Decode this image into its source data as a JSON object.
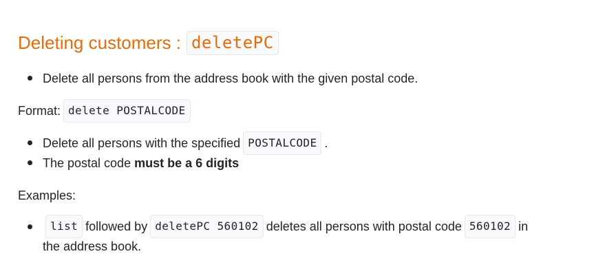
{
  "heading": {
    "text": "Deleting customers :",
    "code": "deletePC"
  },
  "description": {
    "item1": "Delete all persons from the address book with the given postal code."
  },
  "format": {
    "label": "Format:",
    "code": "delete POSTALCODE"
  },
  "details": {
    "item1_prefix": "Delete all persons with the specified",
    "item1_code": "POSTALCODE",
    "item1_suffix": ".",
    "item2_prefix": "The postal code",
    "item2_bold": "must be a 6 digits"
  },
  "examples": {
    "label": "Examples:",
    "code1": "list",
    "text1": "followed by",
    "code2": "deletePC 560102",
    "text2": "deletes all persons with postal code",
    "code3": "560102",
    "text3": "in",
    "text4": "the address book."
  },
  "colors": {
    "heading": "#e46c0a",
    "text": "#212529",
    "code_background": "#f8f9fa"
  }
}
